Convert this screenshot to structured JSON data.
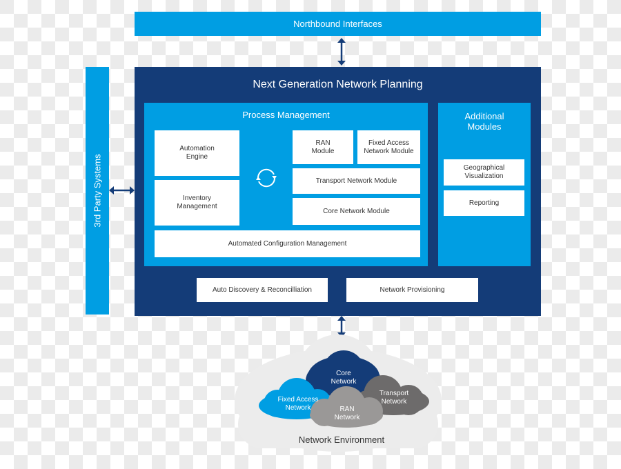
{
  "northbound": {
    "label": "Northbound Interfaces"
  },
  "third_party": {
    "label": "3rd Party Systems"
  },
  "platform": {
    "title": "Next Generation Network Planning",
    "process_management": {
      "title": "Process Management",
      "left_modules": [
        "Automation\nEngine",
        "Inventory\nManagement"
      ],
      "ran_module": "RAN\nModule",
      "fixed_access_module": "Fixed Access\nNetwork Module",
      "transport_module": "Transport Network Module",
      "core_module": "Core Network Module",
      "config_management": "Automated Configuration Management",
      "cycle_icon": "refresh-cycle-icon"
    },
    "additional_modules": {
      "title": "Additional\nModules",
      "items": [
        "Geographical\nVisualization",
        "Reporting"
      ]
    },
    "bottom_services": [
      "Auto Discovery & Reconcilliation",
      "Network Provisioning"
    ]
  },
  "network_environment": {
    "label": "Network Environment",
    "clouds": [
      {
        "label": "Core\nNetwork",
        "color": "#143c78"
      },
      {
        "label": "Fixed Access\nNetwork",
        "color": "#009ee3"
      },
      {
        "label": "Transport\nNetwork",
        "color": "#6d6b6b"
      },
      {
        "label": "RAN\nNetwork",
        "color": "#9a9897"
      }
    ]
  },
  "colors": {
    "dark_blue": "#143c78",
    "light_blue": "#009ee3",
    "white": "#ffffff",
    "environment_gray": "#ececec"
  }
}
